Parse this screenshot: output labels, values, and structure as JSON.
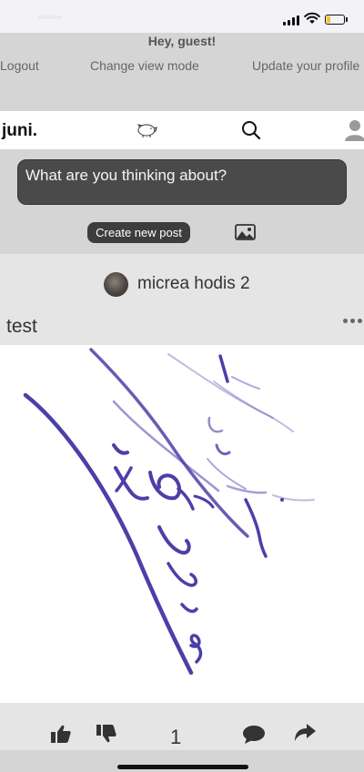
{
  "guest_header": {
    "greeting": "Hey, guest!",
    "menu": [
      "Logout",
      "Change view mode",
      "Update your profile"
    ]
  },
  "nav": {
    "logo": "juni.",
    "icons": [
      "piggy-bank-icon",
      "search-icon",
      "user-avatar-icon"
    ]
  },
  "composer": {
    "placeholder": "What are you thinking about?",
    "create_label": "Create new post",
    "image_icon": "image-icon"
  },
  "post": {
    "author": "micrea hodis 2",
    "title": "test",
    "likes": "1",
    "image_subject": "handwritten signature in blue ink"
  },
  "colors": {
    "header_bg": "#d5d5d5",
    "page_bg": "#e5e5e6",
    "input_bg": "#4a4a4a",
    "ink": "#4b3fa8"
  }
}
